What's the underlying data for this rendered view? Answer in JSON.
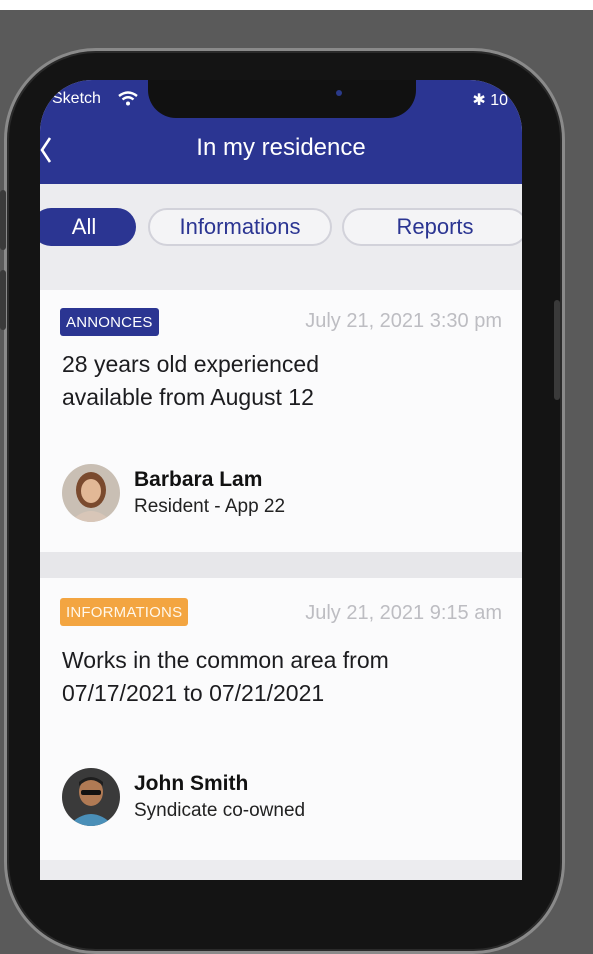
{
  "status_bar": {
    "carrier": "Sketch",
    "battery_text": "10"
  },
  "header": {
    "title": "In my residence",
    "background": "#2b3592"
  },
  "filters": [
    {
      "label": "All",
      "active": true
    },
    {
      "label": "Informations",
      "active": false
    },
    {
      "label": "Reports",
      "active": false
    }
  ],
  "posts": [
    {
      "badge": "ANNONCES",
      "badge_color": "#2b3592",
      "timestamp": "July 21, 2021 3:30 pm",
      "text_lines": [
        "28 years old experienced",
        "available from August 12"
      ],
      "author": {
        "name": "Barbara Lam",
        "role": "Resident - App 22"
      }
    },
    {
      "badge": "INFORMATIONS",
      "badge_color": "#f3a541",
      "timestamp": "July 21, 2021 9:15 am",
      "text_lines": [
        "Works in the common area from",
        "07/17/2021 to 07/21/2021"
      ],
      "author": {
        "name": "John Smith",
        "role": "Syndicate co-owned"
      }
    }
  ]
}
